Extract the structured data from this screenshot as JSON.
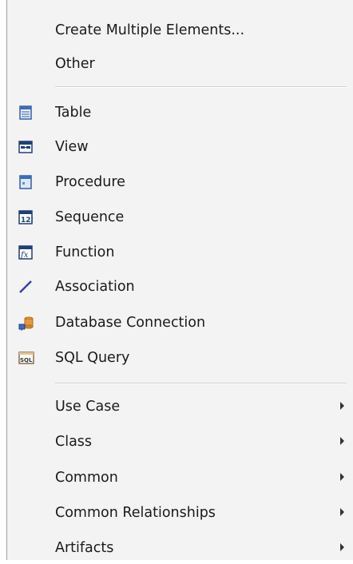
{
  "menu": {
    "group1": [
      {
        "label": "Create Multiple Elements..."
      },
      {
        "label": "Other"
      }
    ],
    "group2": [
      {
        "label": "Table",
        "icon": "table-icon"
      },
      {
        "label": "View",
        "icon": "view-icon"
      },
      {
        "label": "Procedure",
        "icon": "procedure-icon"
      },
      {
        "label": "Sequence",
        "icon": "sequence-icon"
      },
      {
        "label": "Function",
        "icon": "function-icon"
      },
      {
        "label": "Association",
        "icon": "association-icon"
      },
      {
        "label": "Database Connection",
        "icon": "database-connection-icon"
      },
      {
        "label": "SQL Query",
        "icon": "sql-query-icon"
      }
    ],
    "group3": [
      {
        "label": "Use Case",
        "submenu": true
      },
      {
        "label": "Class",
        "submenu": true
      },
      {
        "label": "Common",
        "submenu": true
      },
      {
        "label": "Common Relationships",
        "submenu": true
      },
      {
        "label": "Artifacts",
        "submenu": true
      }
    ]
  },
  "colors": {
    "menu_bg": "#f3f3f3",
    "text": "#1a1a1a",
    "icon_blue": "#3a6fb8",
    "icon_orange": "#d9862a"
  }
}
